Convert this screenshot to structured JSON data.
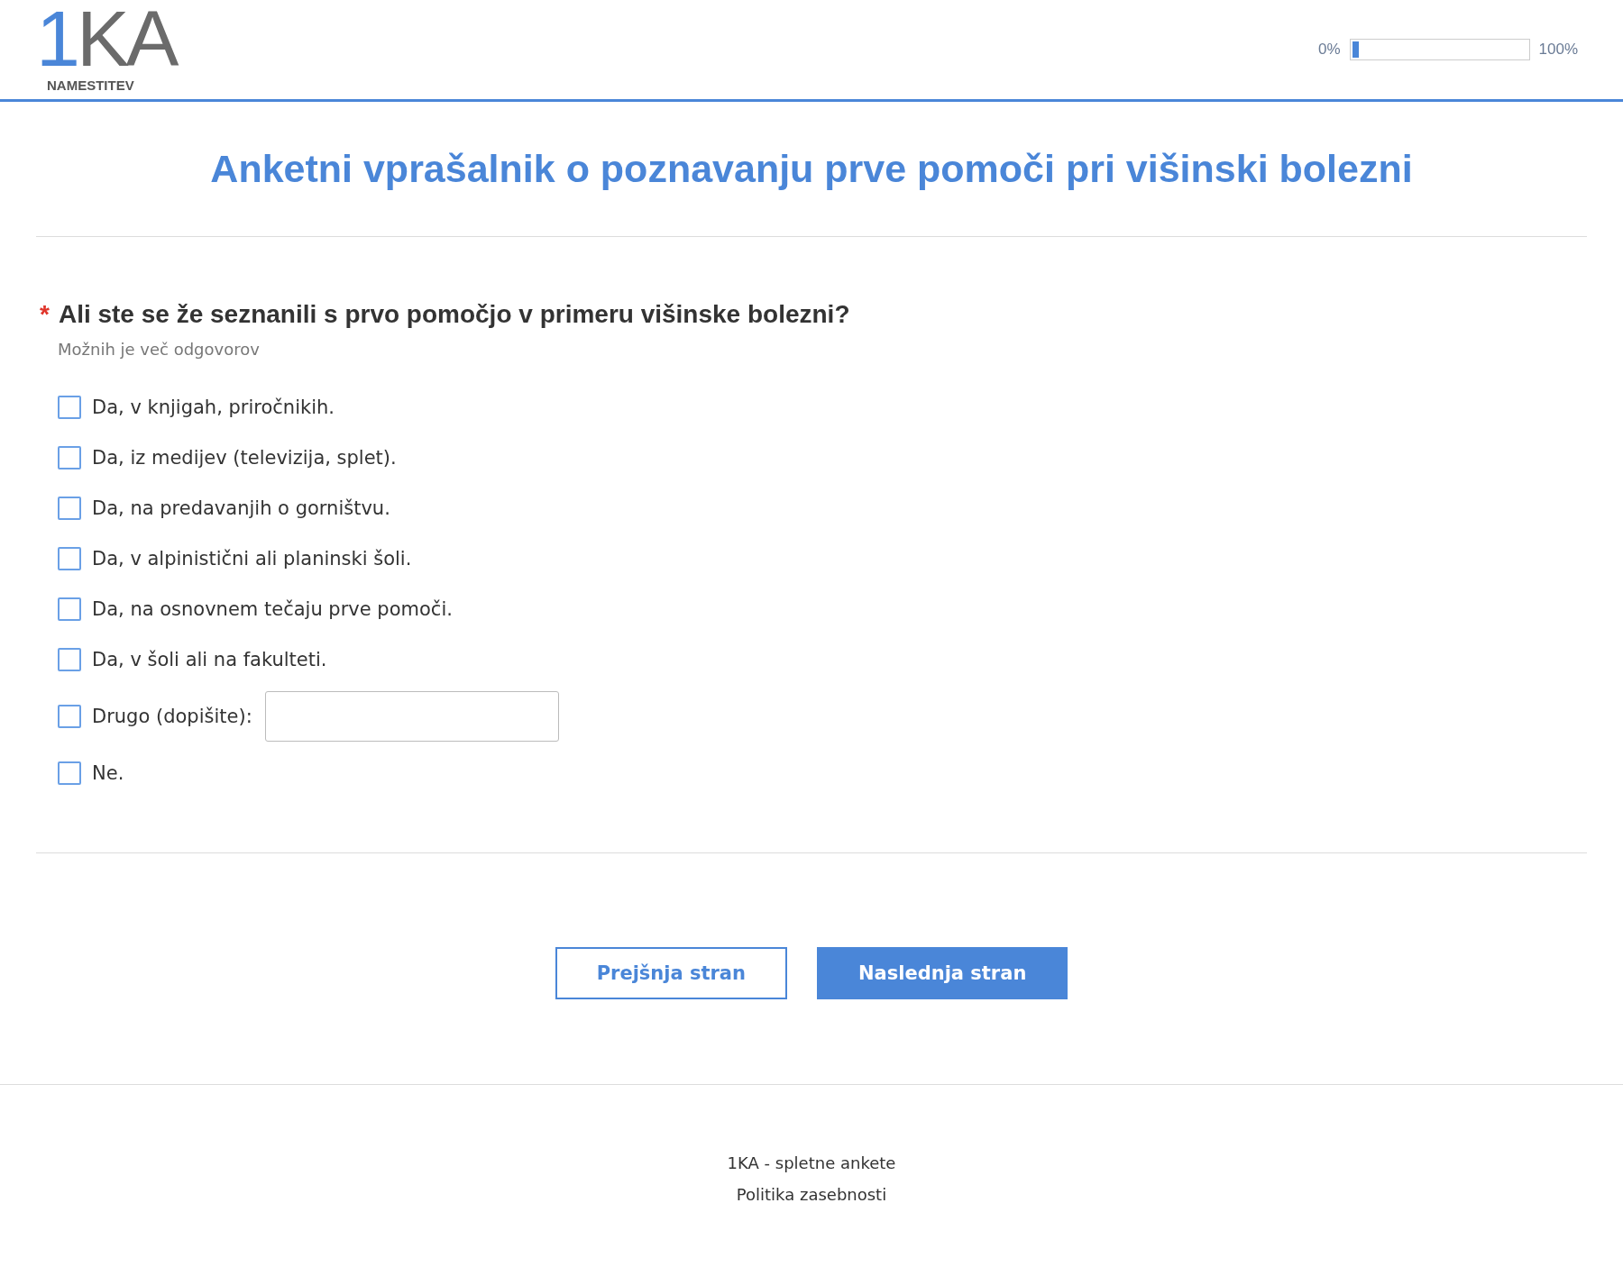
{
  "logo": {
    "mark": "1",
    "letters": "KA",
    "subtitle": "NAMESTITEV"
  },
  "progress": {
    "start": "0%",
    "end": "100%",
    "level": 0.04
  },
  "title": "Anketni vprašalnik o poznavanju prve pomoči pri višinski bolezni",
  "question": {
    "required_mark": "*",
    "text": "Ali ste se že seznanili s prvo pomočjo v primeru višinske bolezni?",
    "hint": "Možnih je več odgovorov",
    "options": [
      {
        "label": "Da, v knjigah, priročnikih.",
        "checked": false
      },
      {
        "label": "Da, iz medijev (televizija, splet).",
        "checked": false
      },
      {
        "label": "Da, na predavanjih o gorništvu.",
        "checked": false
      },
      {
        "label": "Da, v alpinistični ali planinski šoli.",
        "checked": false
      },
      {
        "label": "Da, na osnovnem tečaju prve pomoči.",
        "checked": false
      },
      {
        "label": "Da, v šoli ali na fakulteti.",
        "checked": false
      },
      {
        "label": "Drugo (dopišite):",
        "checked": false,
        "kind": "other"
      },
      {
        "label": "Ne.",
        "checked": false
      }
    ]
  },
  "buttons": [
    {
      "label": "Prejšnja stran",
      "kind": "secondary"
    },
    {
      "label": "Naslednja stran",
      "kind": "primary"
    }
  ],
  "footer": [
    "1KA - spletne ankete",
    "Politika zasebnosti"
  ]
}
